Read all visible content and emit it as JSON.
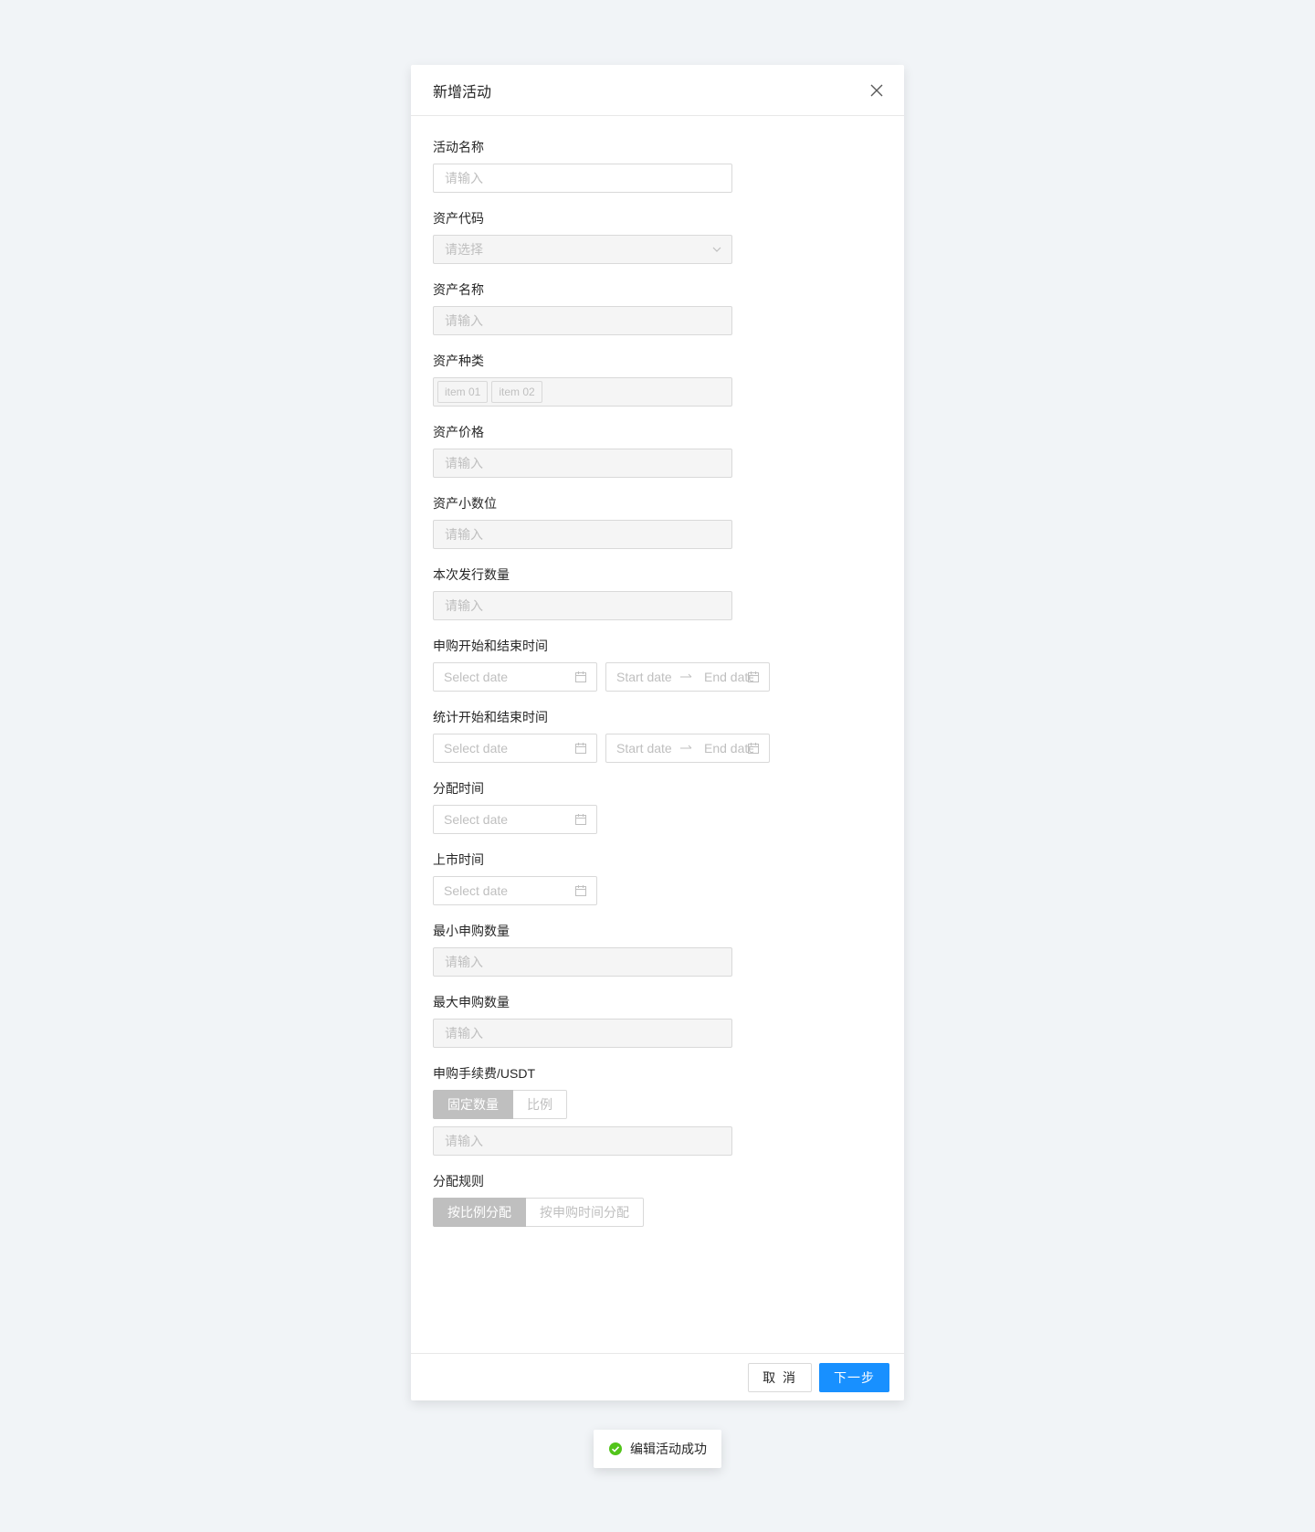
{
  "modal": {
    "title": "新增活动",
    "fields": {
      "activity_name": {
        "label": "活动名称",
        "placeholder": "请输入"
      },
      "asset_code": {
        "label": "资产代码",
        "placeholder": "请选择"
      },
      "asset_name": {
        "label": "资产名称",
        "placeholder": "请输入"
      },
      "asset_type": {
        "label": "资产种类",
        "tags": [
          "item 01",
          "item 02"
        ]
      },
      "asset_price": {
        "label": "资产价格",
        "placeholder": "请输入"
      },
      "asset_decimals": {
        "label": "资产小数位",
        "placeholder": "请输入"
      },
      "issue_amount": {
        "label": "本次发行数量",
        "placeholder": "请输入"
      },
      "subscribe_time": {
        "label": "申购开始和结束时间",
        "date_placeholder": "Select date",
        "start_placeholder": "Start date",
        "end_placeholder": "End date"
      },
      "stats_time": {
        "label": "统计开始和结束时间",
        "date_placeholder": "Select date",
        "start_placeholder": "Start date",
        "end_placeholder": "End date"
      },
      "distribute_time": {
        "label": "分配时间",
        "date_placeholder": "Select date"
      },
      "listing_time": {
        "label": "上市时间",
        "date_placeholder": "Select date"
      },
      "min_subscribe": {
        "label": "最小申购数量",
        "placeholder": "请输入"
      },
      "max_subscribe": {
        "label": "最大申购数量",
        "placeholder": "请输入"
      },
      "fee": {
        "label": "申购手续费/USDT",
        "options": [
          "固定数量",
          "比例"
        ],
        "selected": "固定数量",
        "placeholder": "请输入"
      },
      "rule": {
        "label": "分配规则",
        "options": [
          "按比例分配",
          "按申购时间分配"
        ],
        "selected": "按比例分配"
      }
    },
    "footer": {
      "cancel": "取 消",
      "next": "下一步"
    }
  },
  "toast": {
    "message": "编辑活动成功",
    "icon": "check-circle-icon",
    "color": "#52c41a"
  },
  "colors": {
    "primary": "#1890ff",
    "background": "#f1f4f7",
    "disabled_bg": "#f5f5f5"
  }
}
